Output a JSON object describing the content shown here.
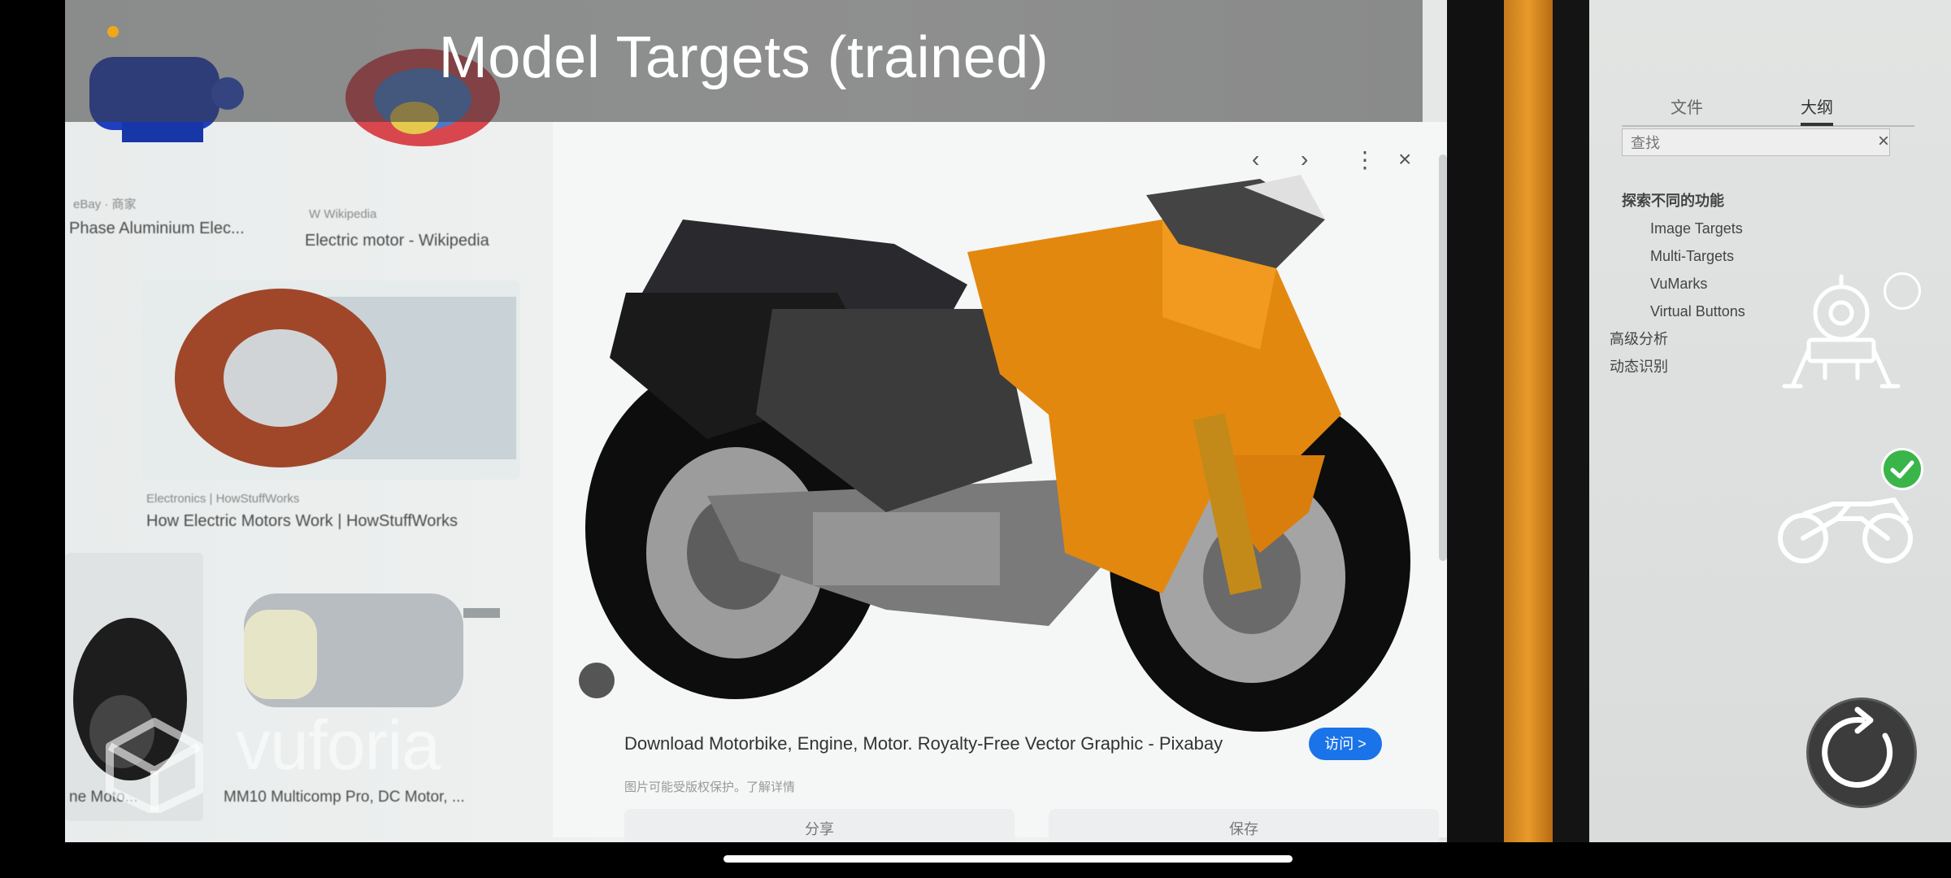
{
  "overlay": {
    "title": "Model Targets (trained)",
    "watermark": "vuforia",
    "reset_button_label": "reset"
  },
  "model_selector": {
    "items": [
      {
        "icon": "lander-icon",
        "selected": false
      },
      {
        "icon": "motorbike-icon",
        "selected": true
      }
    ]
  },
  "background_page": {
    "results": [
      {
        "source": "eBay · 商家",
        "caption": "Phase Aluminium Elec..."
      },
      {
        "source": "W Wikipedia",
        "caption": "Electric motor - Wikipedia"
      },
      {
        "source": "Electronics | HowStuffWorks",
        "caption": "How Electric Motors Work | HowStuffWorks"
      },
      {
        "source": "",
        "caption": "ne Moto..."
      },
      {
        "source": "",
        "caption": "MM10 Multicomp Pro, DC Motor, ..."
      }
    ],
    "preview": {
      "site": "Pixabay",
      "title": "Download Motorbike, Engine, Motor. Royalty-Free Vector Graphic - Pixabay",
      "visit_label": "访问 >",
      "subtitle": "图片可能受版权保护。了解详情",
      "share_label": "分享",
      "save_label": "保存"
    },
    "right_monitor": {
      "tabs": [
        "文件",
        "大纲"
      ],
      "search_placeholder": "查找",
      "outline": [
        "探索不同的功能",
        "Image Targets",
        "Multi-Targets",
        "VuMarks",
        "Virtual Buttons",
        "高级分析",
        "动态识别"
      ]
    }
  }
}
